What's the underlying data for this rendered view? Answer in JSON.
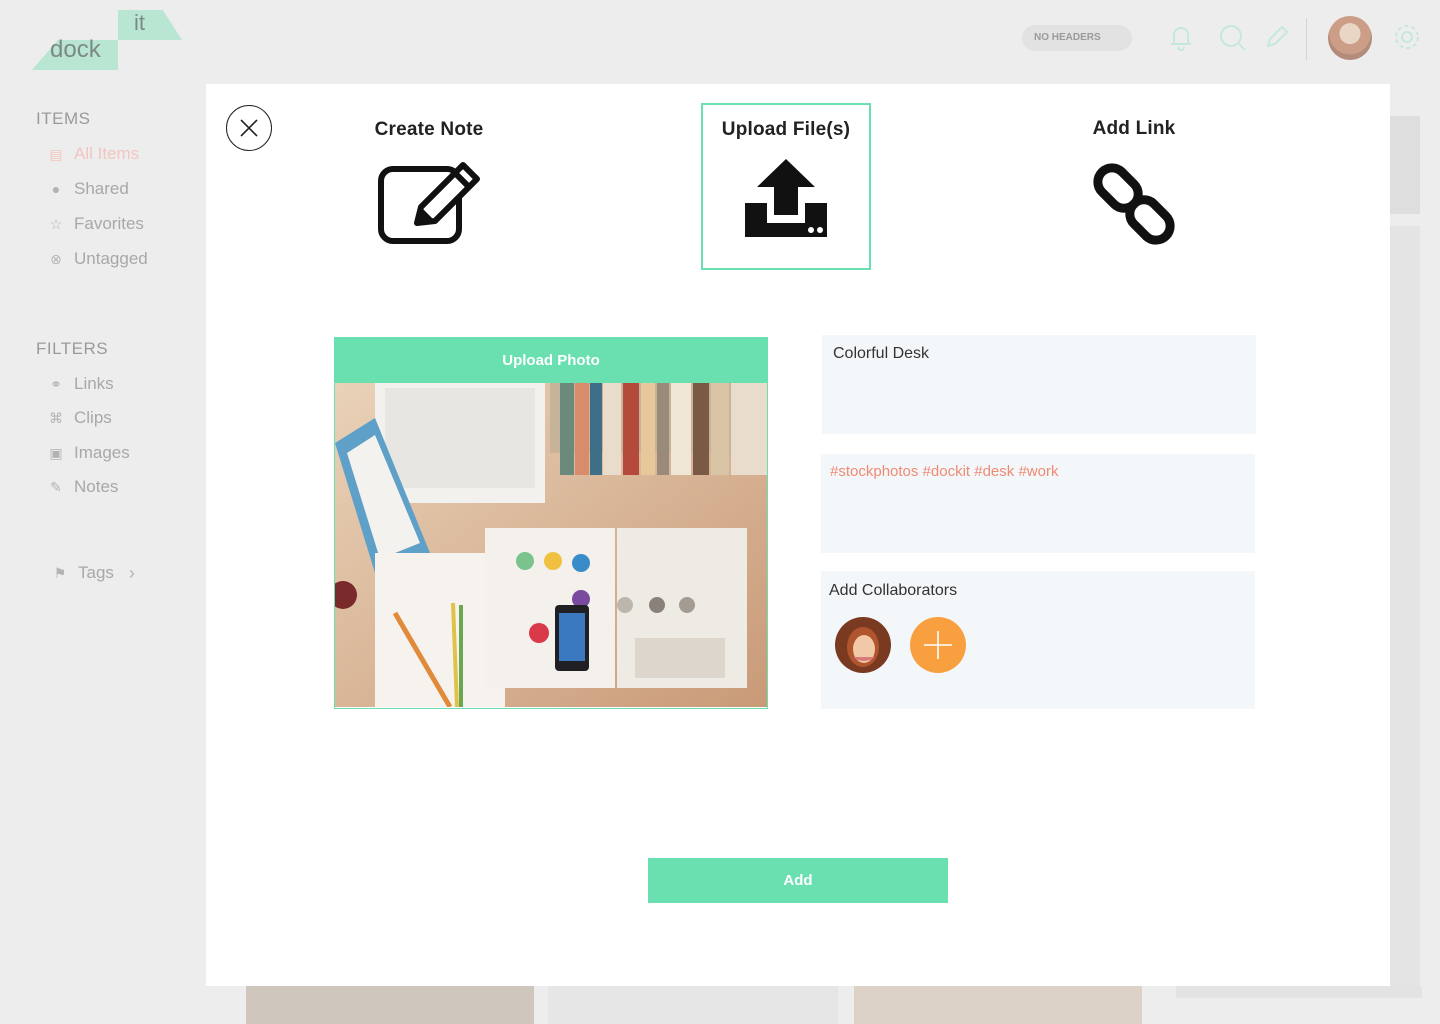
{
  "app": {
    "logo_top": "it",
    "logo_bottom": "dock",
    "header_toggle": "NO HEADERS"
  },
  "sidebar": {
    "items_heading": "ITEMS",
    "items": [
      {
        "label": "All Items",
        "icon": "document-icon"
      },
      {
        "label": "Shared",
        "icon": "users-icon"
      },
      {
        "label": "Favorites",
        "icon": "star-icon"
      },
      {
        "label": "Untagged",
        "icon": "untagged-icon"
      }
    ],
    "filters_heading": "FILTERS",
    "filters": [
      {
        "label": "Links",
        "icon": "link-icon"
      },
      {
        "label": "Clips",
        "icon": "crop-icon"
      },
      {
        "label": "Images",
        "icon": "image-icon"
      },
      {
        "label": "Notes",
        "icon": "edit-icon"
      }
    ],
    "tags_label": "Tags"
  },
  "modal": {
    "options": [
      {
        "label": "Create Note",
        "icon": "edit-note-icon"
      },
      {
        "label": "Upload File(s)",
        "icon": "upload-icon",
        "selected": true
      },
      {
        "label": "Add Link",
        "icon": "chain-link-icon"
      }
    ],
    "upload_label": "Upload Photo",
    "title_value": "Colorful Desk",
    "tags_value": "#stockphotos #dockit #desk #work",
    "collaborators_label": "Add Collaborators",
    "add_label": "Add"
  },
  "colors": {
    "accent": "#6adfb0",
    "tag_color": "#f08a75",
    "add_collaborator": "#f8a040"
  }
}
